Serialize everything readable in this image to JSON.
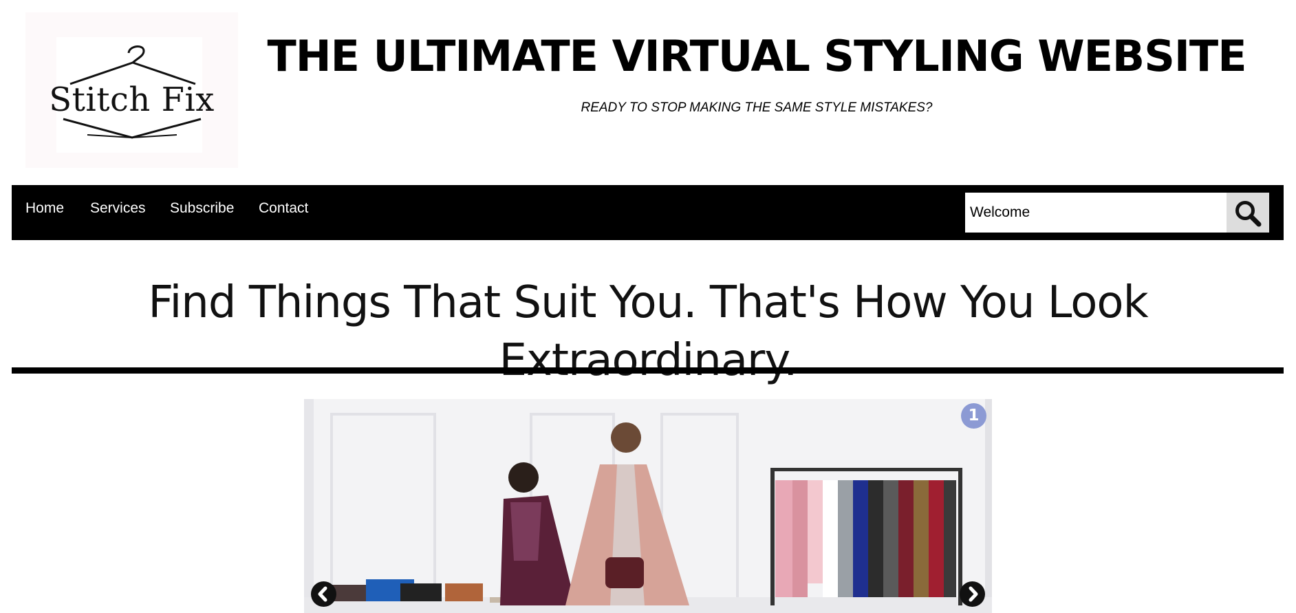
{
  "logo": {
    "text": "Stitch Fix",
    "icon": "hanger-icon"
  },
  "header": {
    "title": "THE ULTIMATE VIRTUAL STYLING WEBSITE",
    "tagline": "READY TO STOP MAKING THE SAME STYLE MISTAKES?"
  },
  "nav": {
    "items": [
      {
        "label": "Home"
      },
      {
        "label": "Services"
      },
      {
        "label": "Subscribe"
      },
      {
        "label": "Contact"
      }
    ],
    "search": {
      "value": "Welcome",
      "icon": "search-icon"
    }
  },
  "main": {
    "headline": "Find Things That Suit You. That's How You Look Extraordinary."
  },
  "slideshow": {
    "slide_number": "1",
    "prev_icon": "chevron-left-icon",
    "next_icon": "chevron-right-icon",
    "colors": {
      "badge": "#8c9ad4",
      "arrow": "#111111"
    }
  }
}
